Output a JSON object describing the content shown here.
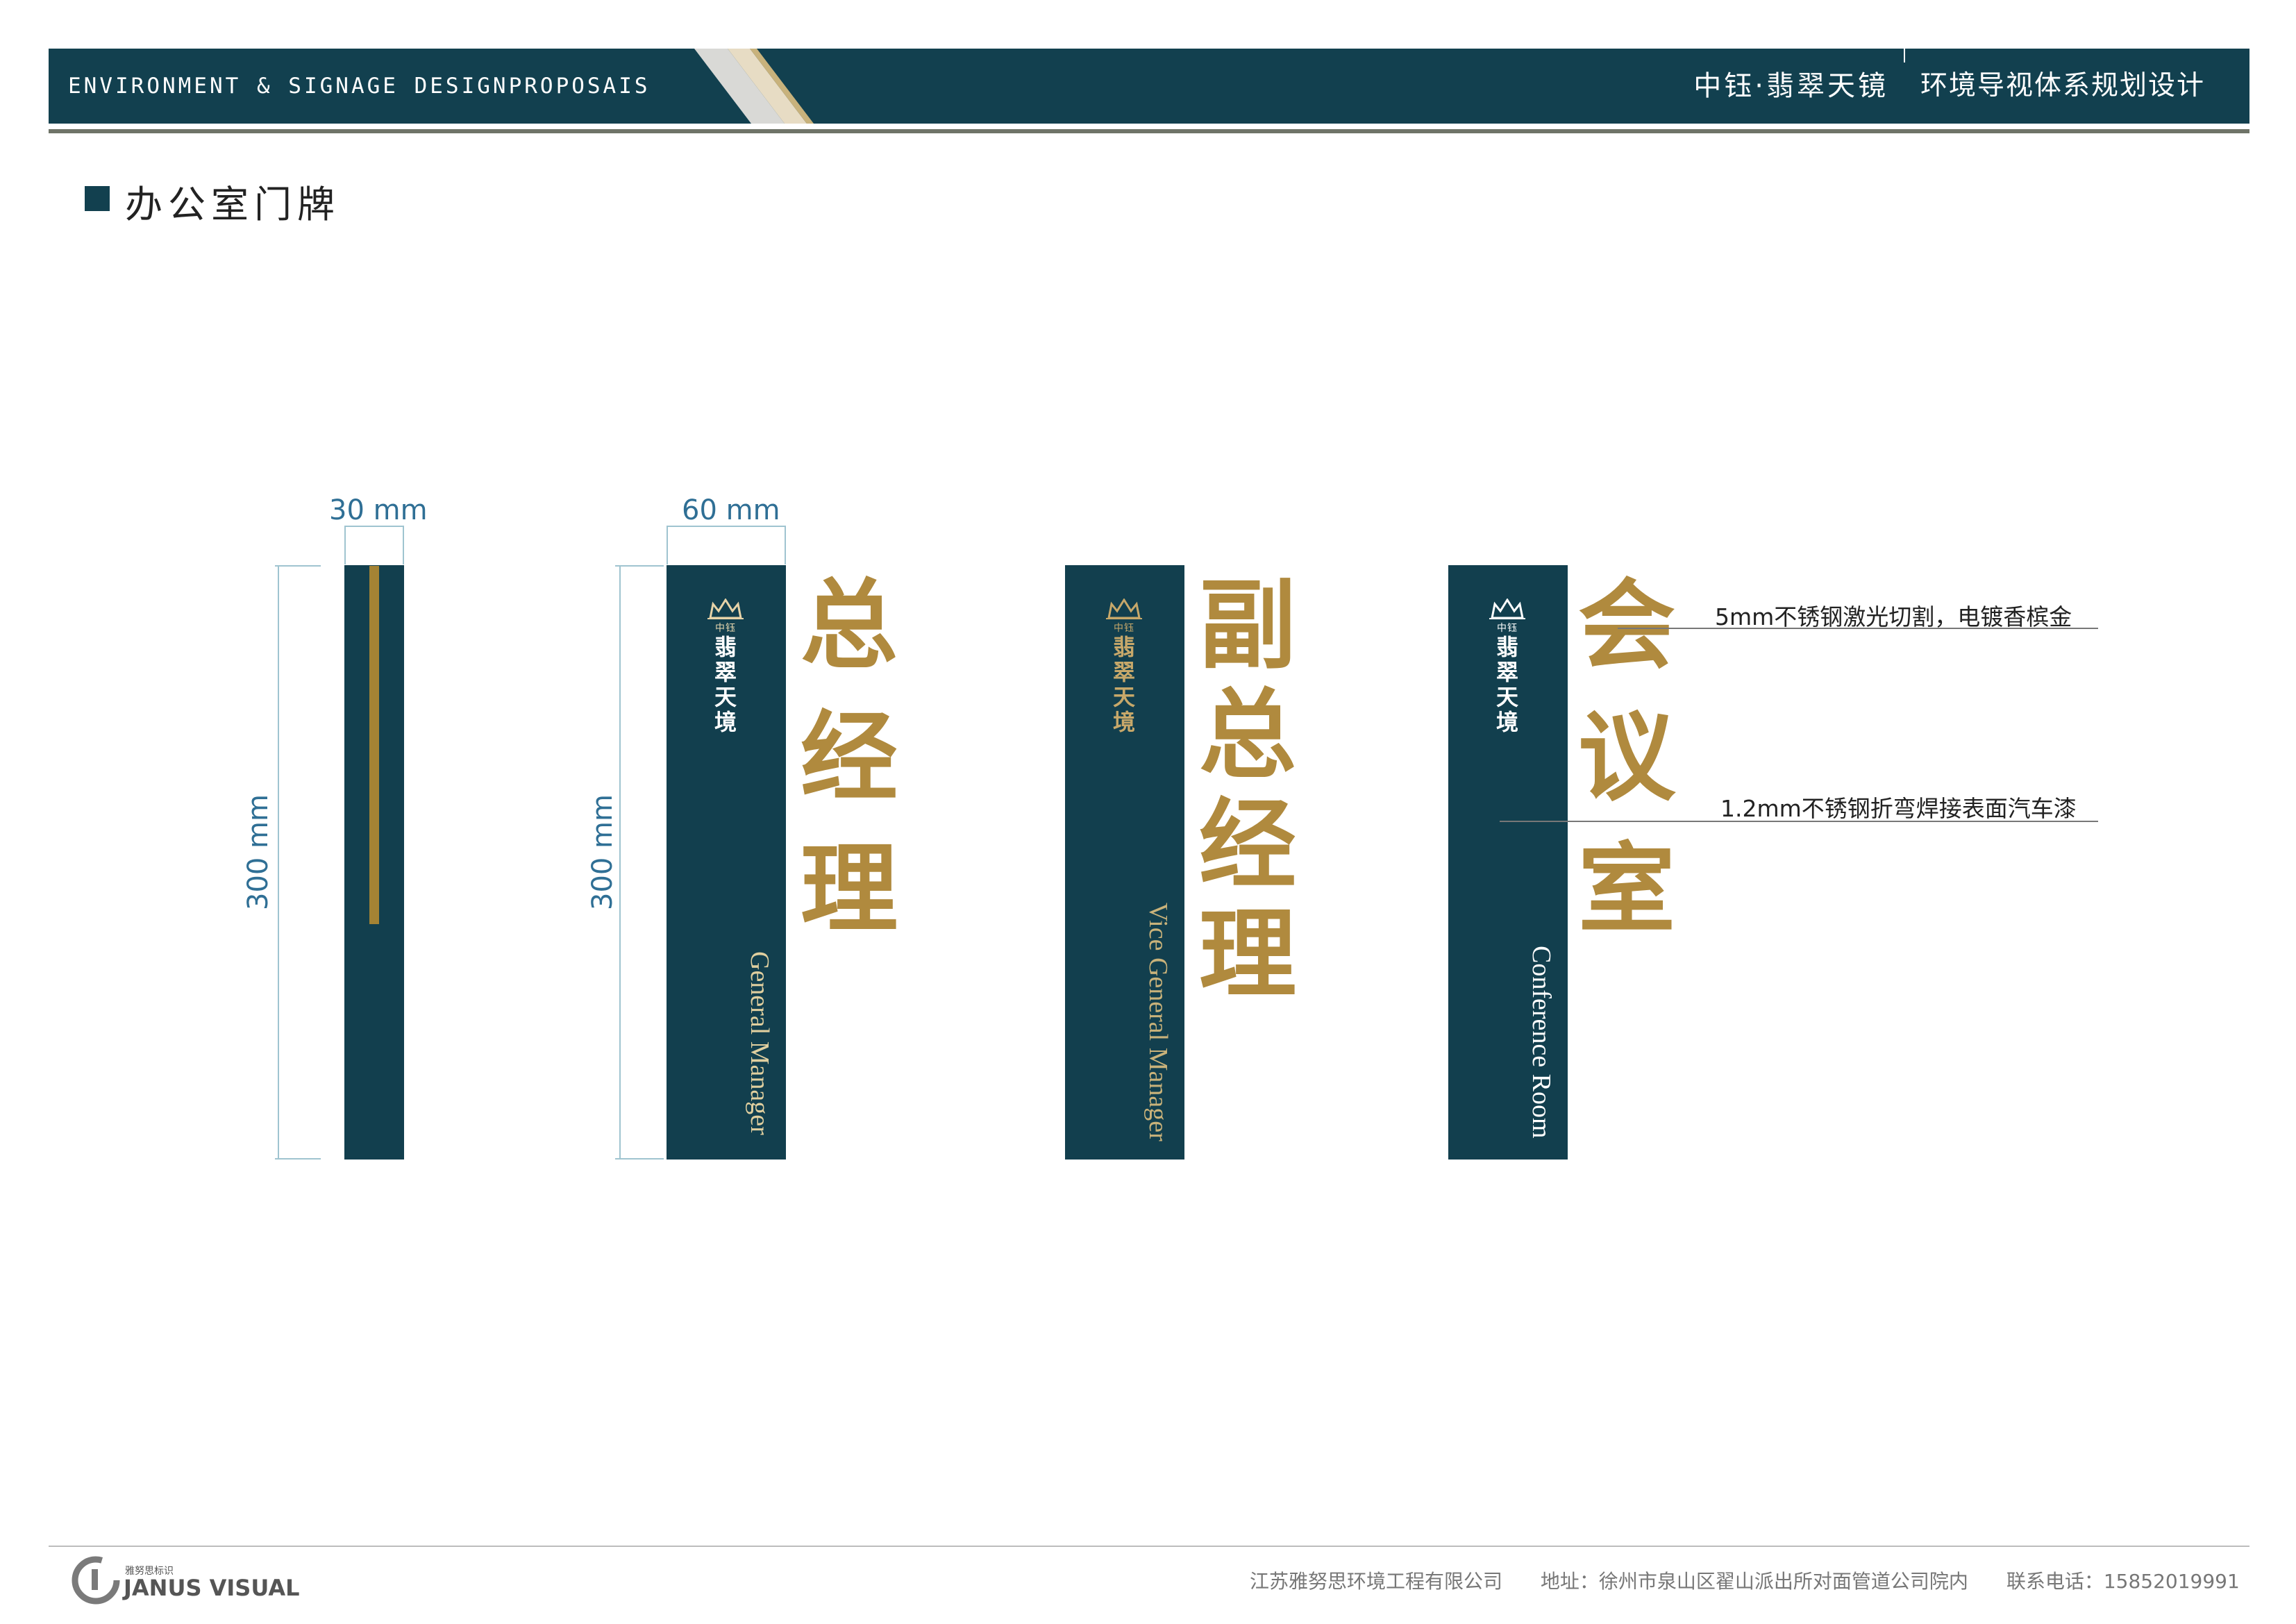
{
  "header": {
    "left_title": "ENVIRONMENT & SIGNAGE DESIGNPROPOSAIS",
    "project_name": "中钰·翡翠天镜",
    "subtitle": "环境导视体系规划设计"
  },
  "section": {
    "title": "办公室门牌"
  },
  "dimensions": {
    "width_side": "30 mm",
    "width_front": "60 mm",
    "height_side": "300 mm",
    "height_front": "300 mm"
  },
  "logo": {
    "small_text": "中钰",
    "name": "翡翠天境"
  },
  "signs": [
    {
      "cn": "总经理",
      "en": "General Manager"
    },
    {
      "cn": "副总经理",
      "en": "Vice General Manager"
    },
    {
      "cn": "会议室",
      "en": "Conference Room"
    }
  ],
  "callouts": [
    "5mm不锈钢激光切割，电镀香槟金",
    "1.2mm不锈钢折弯焊接表面汽车漆"
  ],
  "footer": {
    "brand_cn": "雅努思标识",
    "brand_en": "JANUS VISUAL",
    "company": "江苏雅努思环境工程有限公司",
    "address": "地址：徐州市泉山区翟山派出所对面管道公司院内",
    "phone": "联系电话：15852019991"
  },
  "colors": {
    "primary": "#12404f",
    "gold": "#b08a3e",
    "dimension": "#2f6f95"
  }
}
